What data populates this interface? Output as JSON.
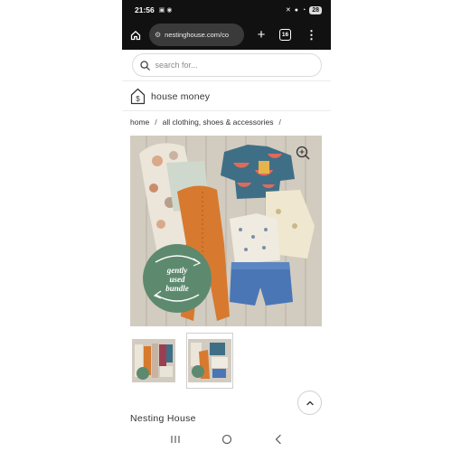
{
  "status_bar": {
    "time": "21:56",
    "left_icons": [
      "screenshot-icon",
      "messenger-icon"
    ],
    "right_icons": [
      "mute-icon",
      "location-icon",
      "wifi-icon",
      "battery-icon"
    ],
    "battery": "28"
  },
  "browser": {
    "url": "nestinghouse.com/co",
    "tab_count": "16",
    "icons": [
      "home-icon",
      "site-settings-icon",
      "new-tab-icon",
      "tab-switcher-icon",
      "menu-icon"
    ]
  },
  "search": {
    "placeholder": "search for..."
  },
  "brand": {
    "name": "house money",
    "logo_icon": "house-dollar-icon"
  },
  "breadcrumb": {
    "items": [
      "home",
      "all clothing, shoes & accessories"
    ],
    "separator": "/"
  },
  "product": {
    "badge_lines": [
      "gently",
      "used",
      "bundle"
    ],
    "badge_color": "#5d8a6e",
    "zoom_icon": "zoom-icon",
    "thumbnails": [
      {
        "selected": false
      },
      {
        "selected": true
      }
    ],
    "vendor": "Nesting House"
  },
  "colors": {
    "wood": "#cfc8bd",
    "orange_romper": "#d77a2f",
    "teal_shirt": "#3f6f86",
    "denim_shorts": "#4a76b5"
  },
  "nav_bar": {
    "icons": [
      "recent-apps-icon",
      "home-circle-icon",
      "back-icon"
    ]
  }
}
